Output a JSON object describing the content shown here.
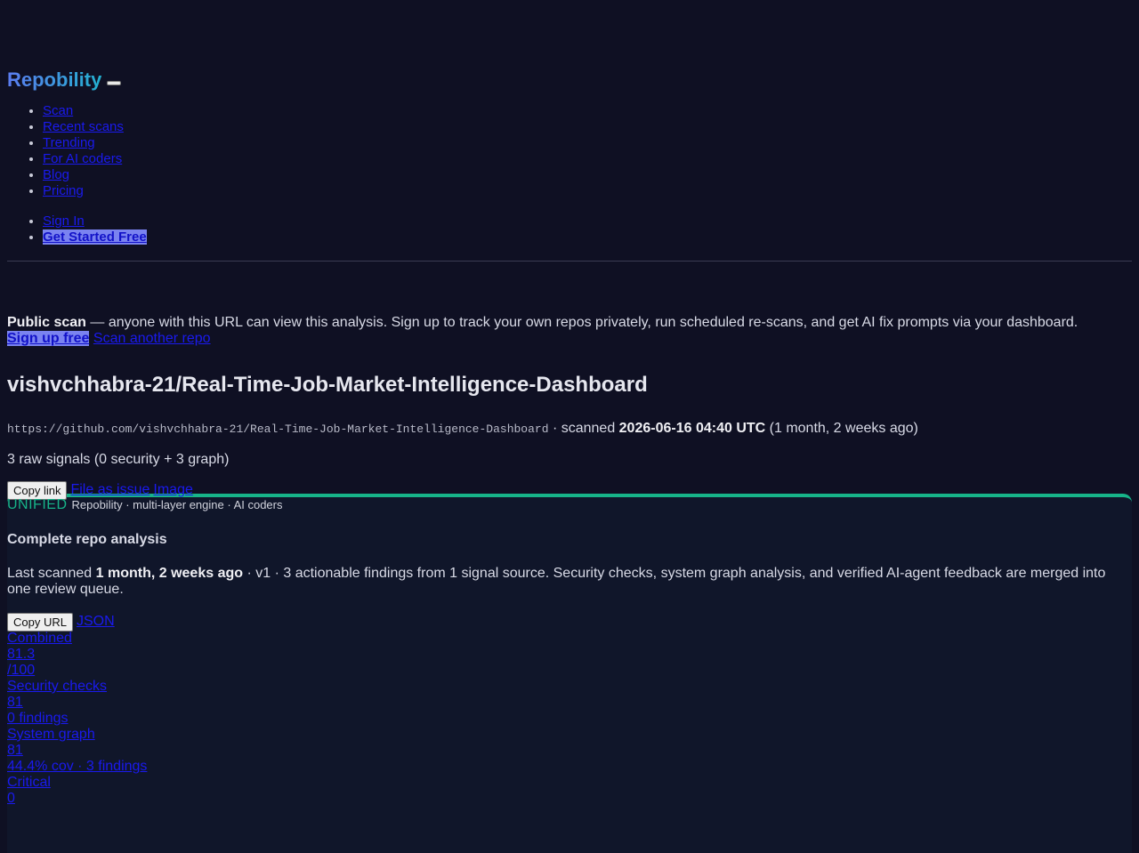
{
  "brand": {
    "name": "Repobility"
  },
  "nav": {
    "items": [
      "Scan",
      "Recent scans",
      "Trending",
      "For AI coders",
      "Blog",
      "Pricing"
    ],
    "auth": {
      "sign_in": "Sign In",
      "get_started": "Get Started Free"
    }
  },
  "notice": {
    "lead": "Public scan",
    "text": " — anyone with this URL can view this analysis. Sign up to track your own repos privately, run scheduled re-scans, and get AI fix prompts via your dashboard.",
    "signup": "Sign up free",
    "scan_another": "Scan another repo"
  },
  "repo": {
    "title": "vishvchhabra-21/Real-Time-Job-Market-Intelligence-Dashboard",
    "url": "https://github.com/vishvchhabra-21/Real-Time-Job-Market-Intelligence-Dashboard",
    "scanned_prefix": " · scanned ",
    "scanned_at": "2026-06-16 04:40 UTC",
    "scanned_ago": " (1 month, 2 weeks ago)",
    "signals": "3 raw signals (0 security + 3 graph)"
  },
  "actions": {
    "copy_link": "Copy link",
    "file_issue": "File as issue",
    "image": "Image",
    "copy_url": "Copy URL",
    "json": "JSON"
  },
  "card": {
    "badge": "UNIFIED",
    "engine": "Repobility · multi-layer engine · AI coders",
    "title": "Complete repo analysis",
    "desc_prefix": "Last scanned ",
    "desc_when": "1 month, 2 weeks ago",
    "desc_rest": " · v1 · 3 actionable findings from 1 signal source. Security checks, system graph analysis, and verified AI-agent feedback are merged into one review queue."
  },
  "scores": [
    {
      "label": "Combined",
      "value": "81.3",
      "sub": "/100"
    },
    {
      "label": "Security checks",
      "value": "81",
      "sub": "0 findings"
    },
    {
      "label": "System graph",
      "value": "81",
      "sub": "44.4% cov · 3 findings"
    },
    {
      "label": "Critical",
      "value": "0",
      "sub": ""
    }
  ],
  "colors": {
    "accent": "#17b489",
    "background": "#0f1023",
    "brand": "#5b7cf0"
  }
}
